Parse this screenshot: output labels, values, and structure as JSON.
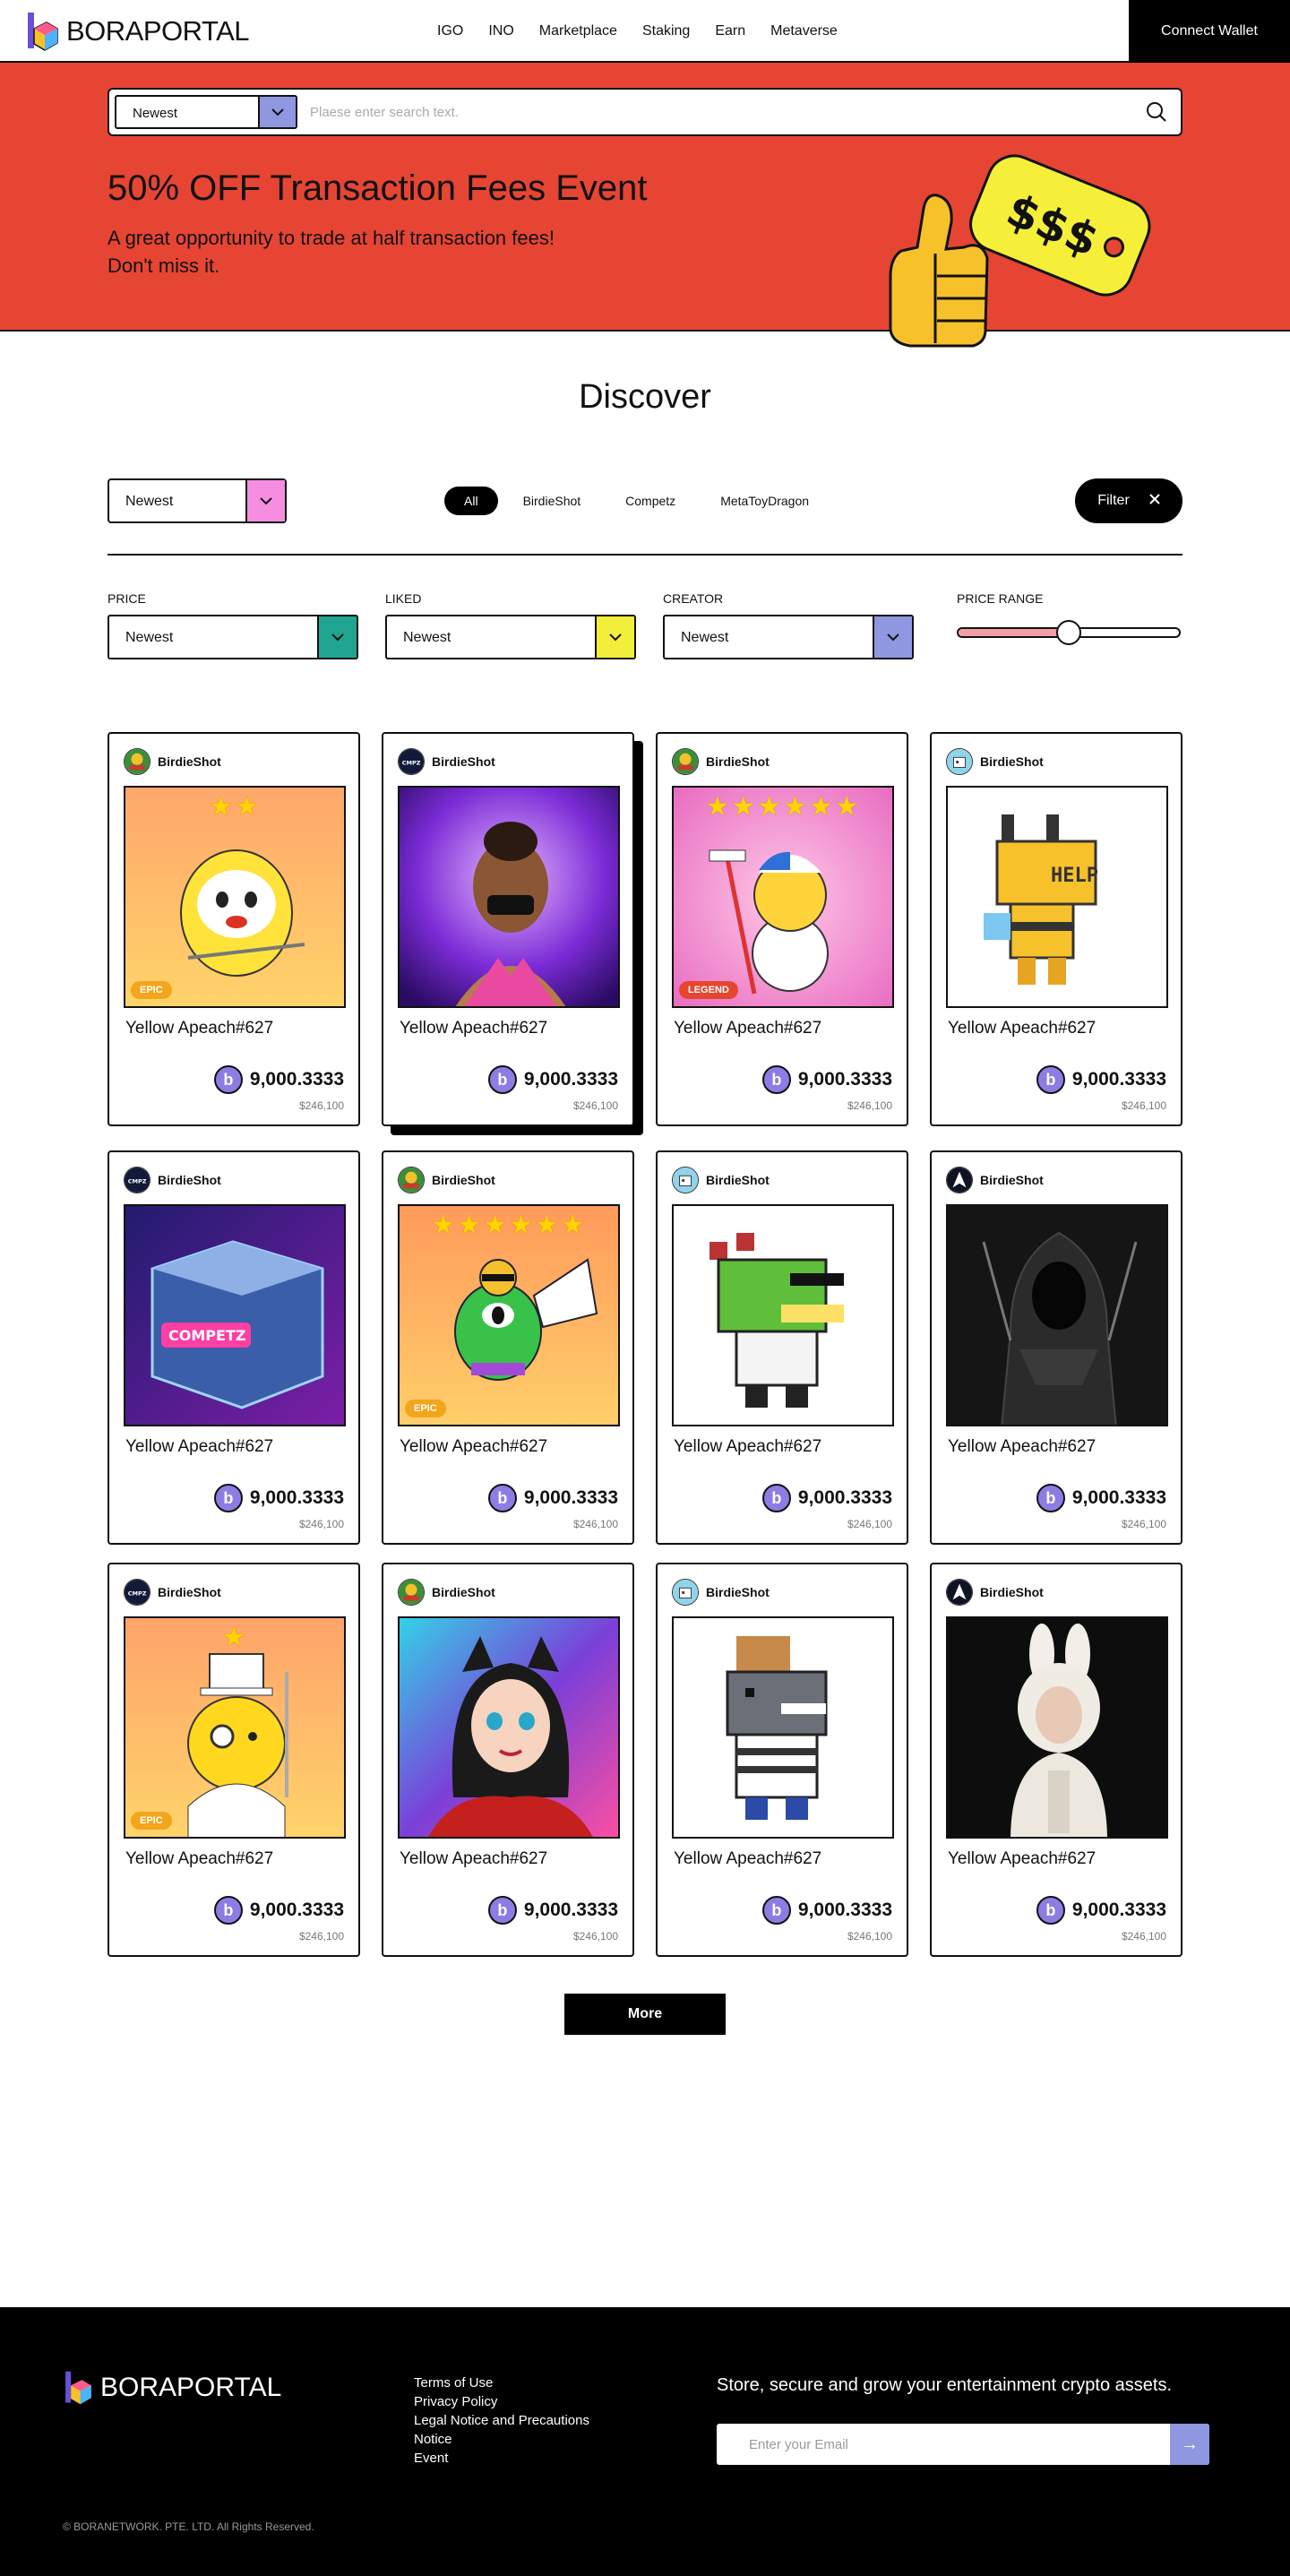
{
  "header": {
    "logo_text": "BORAPORTAL",
    "nav": [
      "IGO",
      "INO",
      "Marketplace",
      "Staking",
      "Earn",
      "Metaverse"
    ],
    "connect_label": "Connect Wallet"
  },
  "banner": {
    "search_select": "Newest",
    "search_placeholder": "Plaese enter search text.",
    "title": "50% OFF Transaction Fees Event",
    "subtitle_line1": "A great opportunity to trade at half transaction fees!",
    "subtitle_line2": "Don't miss it.",
    "tag_text": "$$$",
    "bg_color": "#e64533"
  },
  "discover": {
    "title": "Discover",
    "sort_value": "Newest",
    "tabs": [
      "All",
      "BirdieShot",
      "Competz",
      "MetaToyDragon"
    ],
    "active_tab": 0,
    "filter_label": "Filter",
    "filters": [
      {
        "label": "PRICE",
        "value": "Newest",
        "color": "#1fa58f"
      },
      {
        "label": "LIKED",
        "value": "Newest",
        "color": "#f2ef3a"
      },
      {
        "label": "CREATOR",
        "value": "Newest",
        "color": "#8f97e0"
      }
    ],
    "price_range": {
      "label": "PRICE RANGE",
      "value": 0.5
    }
  },
  "cards": [
    {
      "creator": "BirdieShot",
      "title": "Yellow Apeach#627",
      "price": "9,000.3333",
      "usd": "$246,100",
      "coin": "b",
      "avatar": "golf-avatar-icon",
      "art": "apeach-golfer",
      "stars": "★★",
      "badge": "EPIC"
    },
    {
      "creator": "BirdieShot",
      "title": "Yellow Apeach#627",
      "price": "9,000.3333",
      "usd": "$246,100",
      "coin": "b",
      "avatar": "competz-avatar-icon",
      "art": "stage-woman",
      "stars": "",
      "badge": ""
    },
    {
      "creator": "BirdieShot",
      "title": "Yellow Apeach#627",
      "price": "9,000.3333",
      "usd": "$246,100",
      "coin": "b",
      "avatar": "golf-avatar-icon",
      "art": "snowman-character",
      "stars": "★★★★★★",
      "badge": "LEGEND"
    },
    {
      "creator": "BirdieShot",
      "title": "Yellow Apeach#627",
      "price": "9,000.3333",
      "usd": "$246,100",
      "coin": "b",
      "avatar": "dragon-avatar-icon",
      "art": "pixel-robot-help",
      "stars": "",
      "badge": ""
    },
    {
      "creator": "BirdieShot",
      "title": "Yellow Apeach#627",
      "price": "9,000.3333",
      "usd": "$246,100",
      "coin": "b",
      "avatar": "competz-avatar-icon",
      "art": "competz-box",
      "stars": "",
      "badge": ""
    },
    {
      "creator": "BirdieShot",
      "title": "Yellow Apeach#627",
      "price": "9,000.3333",
      "usd": "$246,100",
      "coin": "b",
      "avatar": "golf-avatar-icon",
      "art": "green-frog-character",
      "stars": "★★★★★★",
      "badge": "EPIC"
    },
    {
      "creator": "BirdieShot",
      "title": "Yellow Apeach#627",
      "price": "9,000.3333",
      "usd": "$246,100",
      "coin": "b",
      "avatar": "dragon-avatar-icon",
      "art": "pixel-dragon",
      "stars": "",
      "badge": ""
    },
    {
      "creator": "BirdieShot",
      "title": "Yellow Apeach#627",
      "price": "9,000.3333",
      "usd": "$246,100",
      "coin": "b",
      "avatar": "warrior-avatar-icon",
      "art": "hooded-reaper",
      "stars": "",
      "badge": ""
    },
    {
      "creator": "BirdieShot",
      "title": "Yellow Apeach#627",
      "price": "9,000.3333",
      "usd": "$246,100",
      "coin": "b",
      "avatar": "competz-avatar-icon",
      "art": "rabbit-gentleman",
      "stars": "★",
      "badge": "EPIC"
    },
    {
      "creator": "BirdieShot",
      "title": "Yellow Apeach#627",
      "price": "9,000.3333",
      "usd": "$246,100",
      "coin": "b",
      "avatar": "golf-avatar-icon",
      "art": "cat-ear-woman",
      "stars": "",
      "badge": ""
    },
    {
      "creator": "BirdieShot",
      "title": "Yellow Apeach#627",
      "price": "9,000.3333",
      "usd": "$246,100",
      "coin": "b",
      "avatar": "dragon-avatar-icon",
      "art": "pixel-shark",
      "stars": "",
      "badge": ""
    },
    {
      "creator": "BirdieShot",
      "title": "Yellow Apeach#627",
      "price": "9,000.3333",
      "usd": "$246,100",
      "coin": "b",
      "avatar": "warrior-avatar-icon",
      "art": "white-bunny-girl",
      "stars": "",
      "badge": ""
    }
  ],
  "more_label": "More",
  "footer": {
    "logo_text": "BORAPORTAL",
    "links": [
      "Terms of Use",
      "Privacy Policy",
      "Legal Notice and Precautions",
      "Notice",
      "Event"
    ],
    "tagline": "Store, secure and grow your entertainment crypto assets.",
    "email_placeholder": "Enter your Email",
    "copyright": "© BORANETWORK. PTE. LTD. All Rights Reserved."
  }
}
